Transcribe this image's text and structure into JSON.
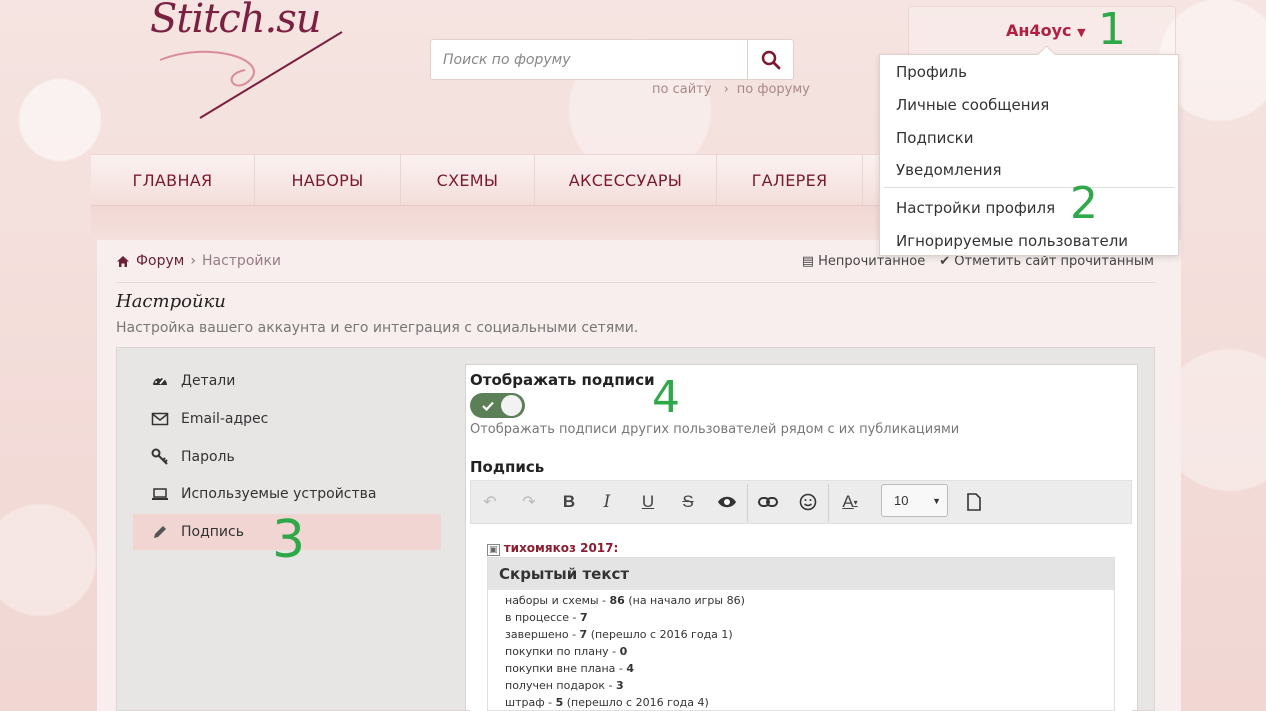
{
  "logo": {
    "text": "Stitch.su"
  },
  "search": {
    "placeholder": "Поиск по форуму",
    "link_site": "по сайту",
    "link_forum": "по форуму"
  },
  "user": {
    "name": "Ан4оус",
    "menu": [
      "Профиль",
      "Личные сообщения",
      "Подписки",
      "Уведомления",
      "Настройки профиля",
      "Игнорируемые пользователи"
    ]
  },
  "nav": [
    "ГЛАВНАЯ",
    "НАБОРЫ",
    "СХЕМЫ",
    "АКСЕССУАРЫ",
    "ГАЛЕРЕЯ"
  ],
  "breadcrumb": {
    "home": "Форум",
    "current": "Настройки"
  },
  "actions": {
    "unread": "Непрочитанное",
    "mark_read": "Отметить сайт прочитанным"
  },
  "page": {
    "title": "Настройки",
    "subtitle": "Настройка вашего аккаунта и его интеграция с социальными сетями."
  },
  "sidebar": [
    "Детали",
    "Email-адрес",
    "Пароль",
    "Используемые устройства",
    "Подпись"
  ],
  "signature_option": {
    "title": "Отображать подписи",
    "desc": "Отображать подписи других пользователей рядом с их публикациями"
  },
  "signature": {
    "title": "Подпись",
    "font_size": "10"
  },
  "editor": {
    "heading": "тихомякоз 2017:",
    "hidden_title": "Скрытый текст",
    "stats": [
      {
        "label": "наборы и схемы - ",
        "value": "86",
        "note": "  (на начало игры 86)"
      },
      {
        "label": "в процессе - ",
        "value": "7",
        "note": ""
      },
      {
        "label": "завершено - ",
        "value": "7",
        "note": " (перешло с 2016 года 1)"
      },
      {
        "label": "покупки по плану - ",
        "value": "0",
        "note": ""
      },
      {
        "label": "покупки вне плана - ",
        "value": "4",
        "note": ""
      },
      {
        "label": "получен подарок - ",
        "value": "3",
        "note": ""
      },
      {
        "label": "штраф - ",
        "value": "5",
        "note": " (перешло с 2016 года 4)"
      }
    ]
  },
  "annotations": [
    "1",
    "2",
    "3",
    "4"
  ]
}
